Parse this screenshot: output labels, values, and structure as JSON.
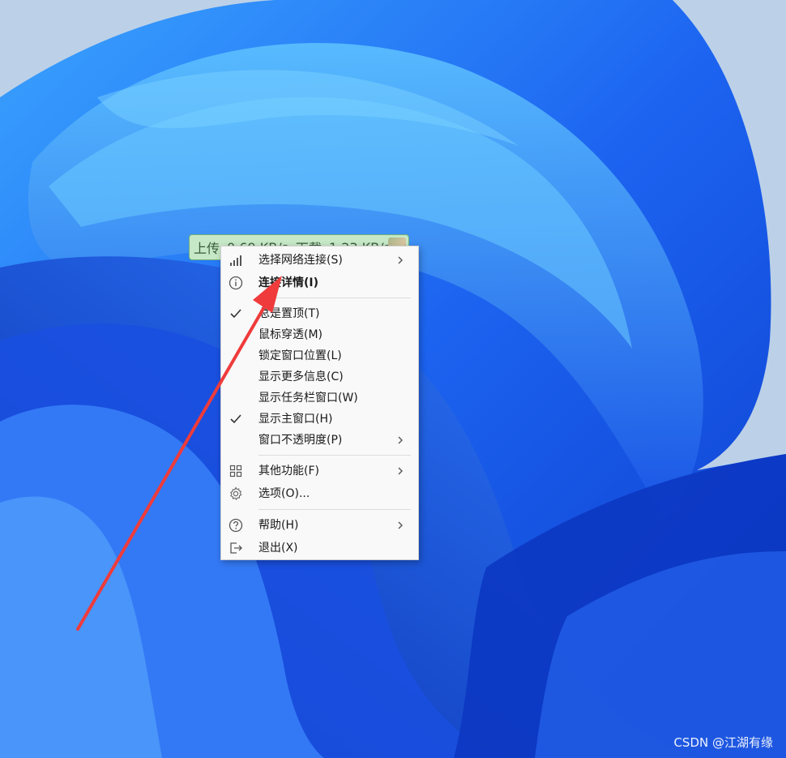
{
  "speed_widget": {
    "upload_label": "上传",
    "upload_value": "0.69 KB/s",
    "download_label": "下载",
    "download_value": "1.23 KB/s"
  },
  "context_menu": {
    "items": [
      {
        "label": "选择网络连接(S)",
        "icon": "signal-bars-icon",
        "submenu": true
      },
      {
        "label": "连接详情(I)",
        "icon": "info-icon",
        "submenu": false,
        "bold": true
      },
      {
        "label": "总是置顶(T)",
        "icon": "check-icon",
        "checked": true
      },
      {
        "label": "鼠标穿透(M)",
        "icon": "",
        "checked": false
      },
      {
        "label": "锁定窗口位置(L)",
        "icon": "",
        "checked": false
      },
      {
        "label": "显示更多信息(C)",
        "icon": "",
        "checked": false
      },
      {
        "label": "显示任务栏窗口(W)",
        "icon": "",
        "checked": false
      },
      {
        "label": "显示主窗口(H)",
        "icon": "check-icon",
        "checked": true
      },
      {
        "label": "窗口不透明度(P)",
        "icon": "",
        "submenu": true
      },
      {
        "label": "其他功能(F)",
        "icon": "grid-icon",
        "submenu": true
      },
      {
        "label": "选项(O)...",
        "icon": "gear-icon",
        "submenu": false
      },
      {
        "label": "帮助(H)",
        "icon": "help-icon",
        "submenu": true
      },
      {
        "label": "退出(X)",
        "icon": "exit-icon",
        "submenu": false
      }
    ]
  },
  "annotation": {
    "color": "#ef3b3b"
  },
  "watermark": "CSDN @江湖有缘",
  "colors": {
    "wallpaper_bg": "#b9cfe6",
    "wallpaper_blue": "#1f5fe8",
    "widget_bg": "#c6e8c6",
    "menu_bg": "#f9f9f9"
  }
}
